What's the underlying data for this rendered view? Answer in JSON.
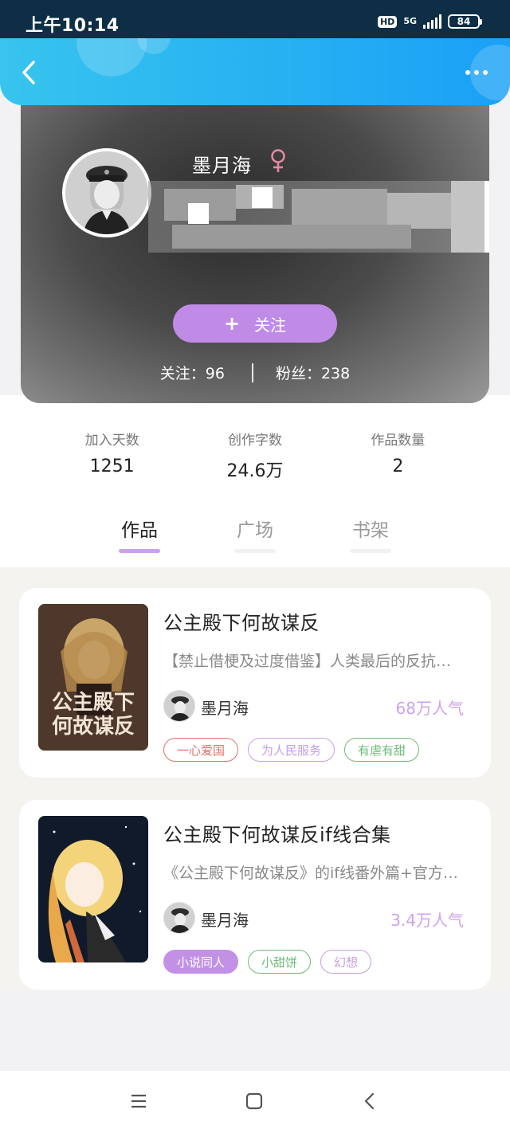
{
  "status_bar": {
    "time": "上午10:14",
    "hd": "HD",
    "network": "5G",
    "battery": "84"
  },
  "header": {
    "back_icon": "chevron-left-icon",
    "more_icon": "more-dots-icon",
    "colors": {
      "start": "#38c4ee",
      "end": "#1aa0f6"
    }
  },
  "profile": {
    "username": "墨月海",
    "gender_icon": "female-icon",
    "follow_button": {
      "plus": "+",
      "label": "关注"
    },
    "following": "关注：96",
    "followers": "粉丝：238"
  },
  "stats": [
    {
      "label": "加入天数",
      "value": "1251"
    },
    {
      "label": "创作字数",
      "value": "24.6万"
    },
    {
      "label": "作品数量",
      "value": "2"
    }
  ],
  "tabs": [
    {
      "label": "作品",
      "active": true
    },
    {
      "label": "广场",
      "active": false
    },
    {
      "label": "书架",
      "active": false
    }
  ],
  "works": [
    {
      "title": "公主殿下何故谋反",
      "description": "【禁止借梗及过度借鉴】人类最后的反抗…",
      "author": "墨月海",
      "popularity": "68万人气",
      "cover_text": "公主殿下何故谋反",
      "tags": [
        {
          "label": "一心爱国",
          "color": "#e0706a",
          "filled": false
        },
        {
          "label": "为人民服务",
          "color": "#c6a0e2",
          "filled": false
        },
        {
          "label": "有虐有甜",
          "color": "#6dbb78",
          "filled": false
        }
      ]
    },
    {
      "title": "公主殿下何故谋反if线合集",
      "description": "《公主殿下何故谋反》的if线番外篇+官方…",
      "author": "墨月海",
      "popularity": "3.4万人气",
      "tags": [
        {
          "label": "小说同人",
          "color": "#c291e6",
          "filled": true
        },
        {
          "label": "小甜饼",
          "color": "#6dbb78",
          "filled": false
        },
        {
          "label": "幻想",
          "color": "#c6a0e2",
          "filled": false
        }
      ]
    }
  ],
  "nav_bar": {
    "menu_icon": "menu-icon",
    "home_icon": "home-square-icon",
    "back_icon": "back-triangle-icon"
  },
  "accent_color": "#c08be6"
}
